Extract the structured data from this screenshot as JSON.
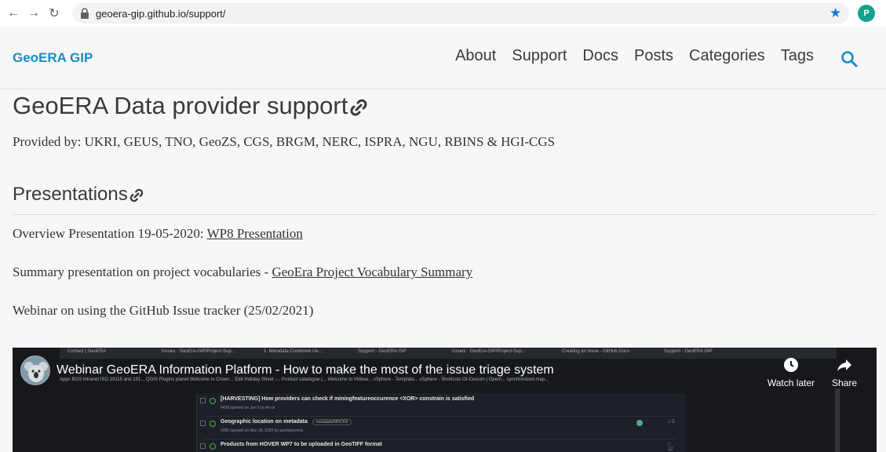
{
  "browser": {
    "url": "geoera-gip.github.io/support/",
    "profile_initial": "P",
    "accent_color": "#1a73e8"
  },
  "site": {
    "logo": "GeoERA GIP",
    "logo_color": "#1a8cc4",
    "nav": [
      "About",
      "Support",
      "Docs",
      "Posts",
      "Categories",
      "Tags"
    ]
  },
  "page": {
    "title": "GeoERA Data provider support",
    "provided_by": "Provided by: UKRI, GEUS, TNO, GeoZS, CGS, BRGM, NERC, ISPRA, NGU, RBINS & HGI-CGS",
    "section_title": "Presentations",
    "overview_text": "Overview Presentation 19-05-2020: ",
    "overview_link": "WP8 Presentation",
    "summary_text": "Summary presentation on project vocabularies - ",
    "summary_link": "GeoEra Project Vocabulary Summary",
    "webinar_text": "Webinar on using the GitHub Issue tracker (25/02/2021)"
  },
  "video": {
    "title": "Webinar GeoERA Information Platform - How to make the most of the issue triage system",
    "watch_later": "Watch later",
    "share": "Share",
    "tabs": [
      "Contact | GeoERA",
      "Issues · GeoEra-GIP/Project-Sup...",
      "1. Metadata Cookbook Ue...",
      "Support - GeoERA GIP",
      "Issues · GeoEra-GIP/Project-Sup...",
      "Creating an issue - GitHub Docs",
      "Support - GeoERA GIP"
    ],
    "bookmarks": "Apps   BGS Intranet   ISO 19115 and 191...   QGIS Plugins planet   Welcome to Crown...   Edit Holiday Sheet -...   Product catalogue (...   Welcome to VMwar...   vSphere - Template...   vSphere - Shortcuts   OI-Cesium | Openl...   synchronized map...",
    "issues": [
      {
        "title": "[HARVESTING] How providers can check if miningfeatureoccurence <XOR> constrain is satisfied",
        "sub": "#428 opened on Jan 5 by Ari ol",
        "tag": "",
        "comments": ""
      },
      {
        "title": "Geographic location on metadata",
        "sub": "#281 opened on Nov 18, 2020 by auretepereira",
        "tag": "metadata/MRCKA",
        "comments": "5"
      },
      {
        "title": "Products from HOVER WP7 to be uploaded in GeoTIFF format",
        "sub": "",
        "tag": "",
        "comments": "12"
      }
    ]
  }
}
